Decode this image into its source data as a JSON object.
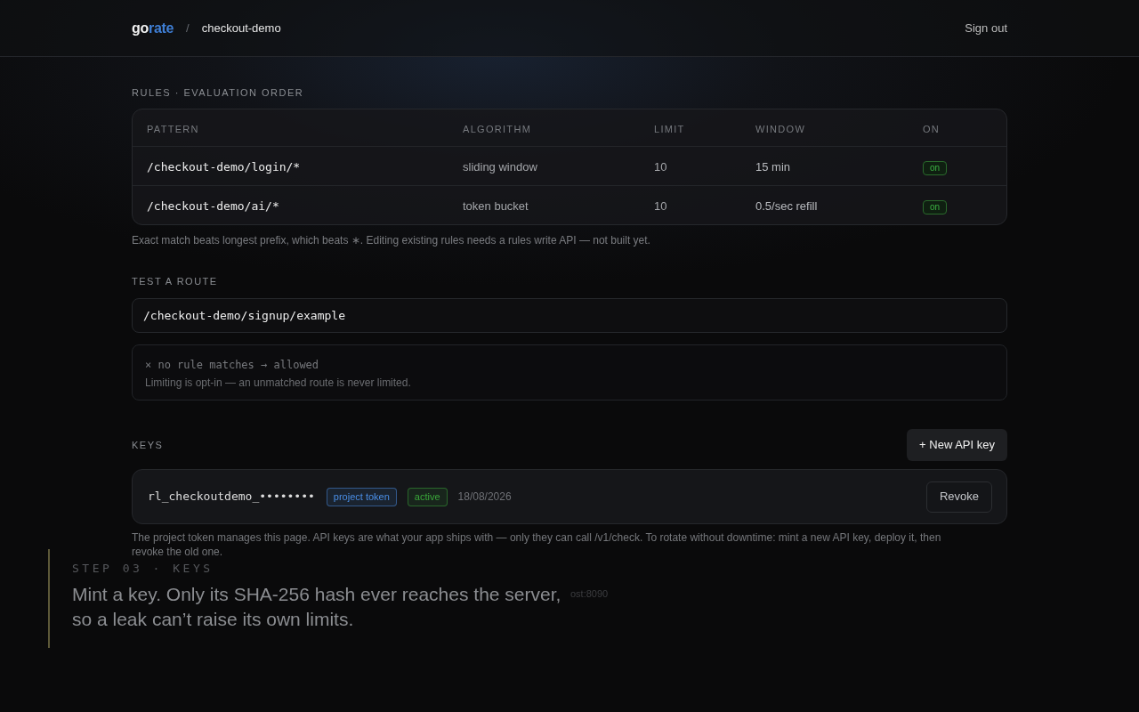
{
  "header": {
    "logo": {
      "parts": [
        {
          "text": "go",
          "color": "#f2f2f2"
        },
        {
          "text": "rate",
          "color": "#3f7fd6"
        }
      ]
    },
    "separator": "/",
    "project": "checkout-demo",
    "sign_out": "Sign out"
  },
  "rules": {
    "title": "RULES · EVALUATION ORDER",
    "columns": [
      "PATTERN",
      "ALGORITHM",
      "LIMIT",
      "WINDOW",
      "ON"
    ],
    "rows": [
      {
        "pattern": "/checkout-demo/login/*",
        "algorithm": "sliding window",
        "limit": "10",
        "window": "15 min",
        "on": true,
        "on_label": "on"
      },
      {
        "pattern": "/checkout-demo/ai/*",
        "algorithm": "token bucket",
        "limit": "10",
        "window": "0.5/sec refill",
        "on": true,
        "on_label": "on"
      }
    ],
    "note": "Exact match beats longest prefix, which beats ∗. Editing existing rules needs a rules write API — not built yet."
  },
  "test_route": {
    "title": "TEST A ROUTE",
    "input": {
      "value": "/checkout-demo/signup/example"
    },
    "result": {
      "line": "× no rule matches → allowed",
      "detail": "Limiting is opt-in — an unmatched route is never limited."
    }
  },
  "keys": {
    "title": "KEYS",
    "new_button": "+ New API key",
    "items": [
      {
        "key": "rl_checkoutdemo_••••••••",
        "badges": [
          {
            "label": "project token",
            "color": "#4a8ee6"
          },
          {
            "label": "active",
            "color": "#3aa83a"
          }
        ],
        "date": "18/08/2026",
        "action": "Revoke"
      }
    ],
    "note": "The project token manages this page. API keys are what your app ships with — only they can call /v1/check. To rotate without downtime: mint a new API key, deploy it, then revoke the old one."
  },
  "footer_text": "ost:8090",
  "caption": {
    "step": "STEP 03 · KEYS",
    "lines": [
      "Mint a key. Only its SHA-256 hash ever reaches the server,",
      "so a leak can’t raise its own limits."
    ]
  }
}
